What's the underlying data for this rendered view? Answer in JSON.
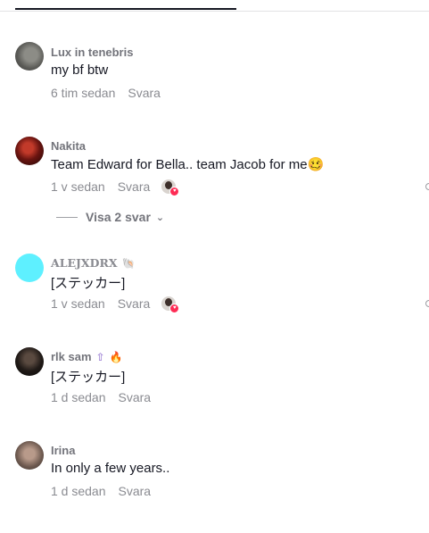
{
  "comments": [
    {
      "username": "Lux in tenebris",
      "text": "my bf btw",
      "time": "6 tim sedan",
      "reply_label": "Svara",
      "avatar_icon": "avatar-photo"
    },
    {
      "username": "Nakita",
      "text": "Team Edward for Bella.. team Jacob for me",
      "emoji": "🥴",
      "time": "1 v sedan",
      "reply_label": "Svara",
      "avatar_icon": "avatar-photo",
      "view_replies": "Visa 2 svar"
    },
    {
      "username": "ALEJXDRX",
      "badge": "🐚",
      "text": "[ステッカー]",
      "time": "1 v sedan",
      "reply_label": "Svara",
      "avatar_color": "#5ef0ff"
    },
    {
      "username": "rlk sam",
      "badge": "🔥",
      "text": "[ステッカー]",
      "time": "1 d sedan",
      "reply_label": "Svara",
      "avatar_icon": "avatar-photo"
    },
    {
      "username": "Irina",
      "text": "In only a few years..",
      "time": "1 d sedan",
      "reply_label": "Svara",
      "avatar_icon": "avatar-photo"
    }
  ],
  "colors": {
    "text": "#161823",
    "muted": "#8a8b91",
    "like_accent": "#fe2c55",
    "tab_underline": "#161823"
  }
}
